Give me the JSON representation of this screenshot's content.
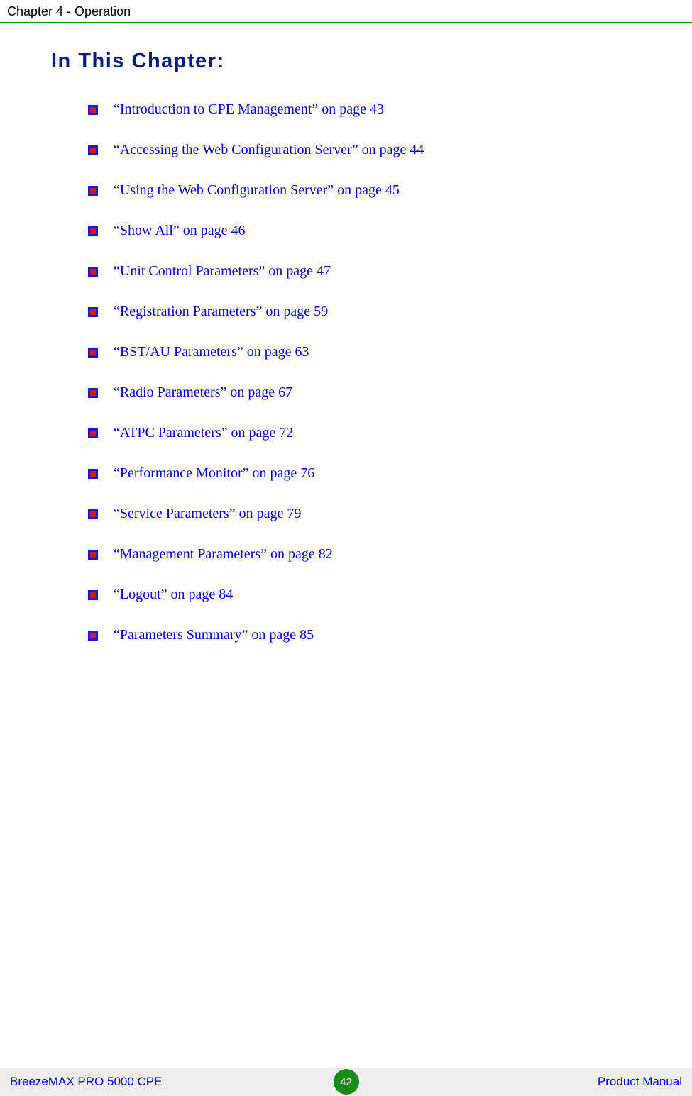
{
  "header": {
    "chapter_label": "Chapter 4 - Operation"
  },
  "content": {
    "heading": "In This Chapter:",
    "items": [
      "“Introduction to CPE Management” on page 43",
      "“Accessing the Web Configuration Server” on page 44",
      "“Using the Web Configuration Server” on page 45",
      "“Show All” on page 46",
      "“Unit Control Parameters” on page 47",
      "“Registration Parameters” on page 59",
      "“BST/AU Parameters” on page 63",
      "“Radio Parameters” on page 67",
      "“ATPC Parameters” on page 72",
      "“Performance Monitor” on page 76",
      "“Service Parameters” on page 79",
      "“Management Parameters” on page 82",
      "“Logout” on page 84",
      "“Parameters Summary” on page 85"
    ]
  },
  "footer": {
    "left": "BreezeMAX PRO 5000 CPE",
    "page": "42",
    "right": "Product Manual"
  },
  "icons": {
    "bullet": "square-bullet-icon"
  },
  "colors": {
    "heading": "#001a80",
    "link": "#0000cc",
    "accent_green": "#1a8a1a",
    "bullet_outer": "#1818d8",
    "bullet_inner": "#d01818",
    "footer_bg": "#eeeeee"
  }
}
